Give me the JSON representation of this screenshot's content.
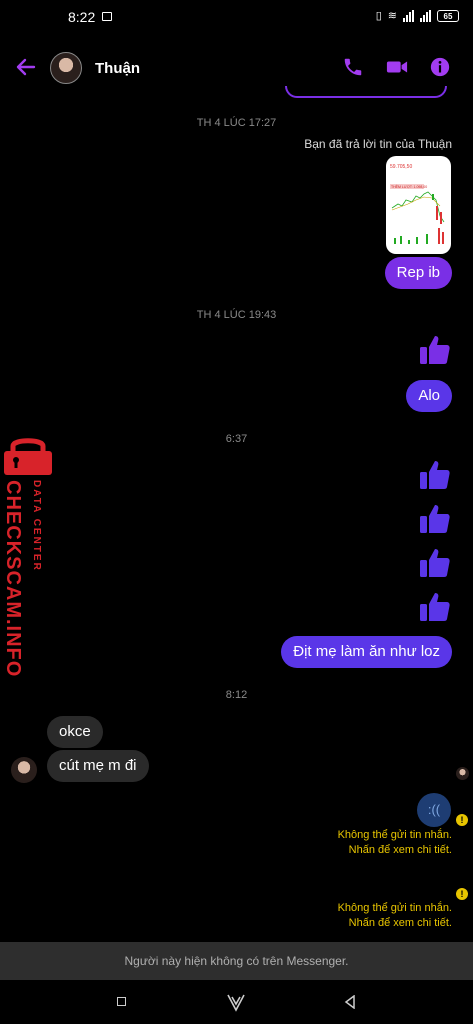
{
  "status_bar": {
    "time": "8:22",
    "battery": "65"
  },
  "header": {
    "contact_name": "Thuận"
  },
  "messages": {
    "ts1": "TH 4 LÚC 17:27",
    "reply_note": "Bạn đã trả lời tin của Thuận",
    "chart_image": {
      "price": "59.705,50",
      "tag": "THÊM LƯỢT: 1.098,00"
    },
    "rep_ib": "Rep ib",
    "ts2": "TH 4 LÚC 19:43",
    "alo": "Alo",
    "ts3": "6:37",
    "long_msg": "Địt mẹ làm ăn như loz",
    "ts4": "8:12",
    "in1": "okce",
    "in2": "cút mẹ  m đi",
    "failed_text": ":((",
    "error1_line1": "Không thể gửi tin nhắn.",
    "error1_line2": "Nhấn để xem chi tiết.",
    "error2_line1": "Không thể gửi tin nhắn.",
    "error2_line2": "Nhấn để xem chi tiết."
  },
  "notice": "Người này hiện không có trên Messenger.",
  "watermark": {
    "top": "DATA CENTER",
    "main": "CHECKSCAM.INFO"
  },
  "colors": {
    "accent": "#a23cf0",
    "bubble": "#5a36e8",
    "warning": "#e8c500"
  }
}
